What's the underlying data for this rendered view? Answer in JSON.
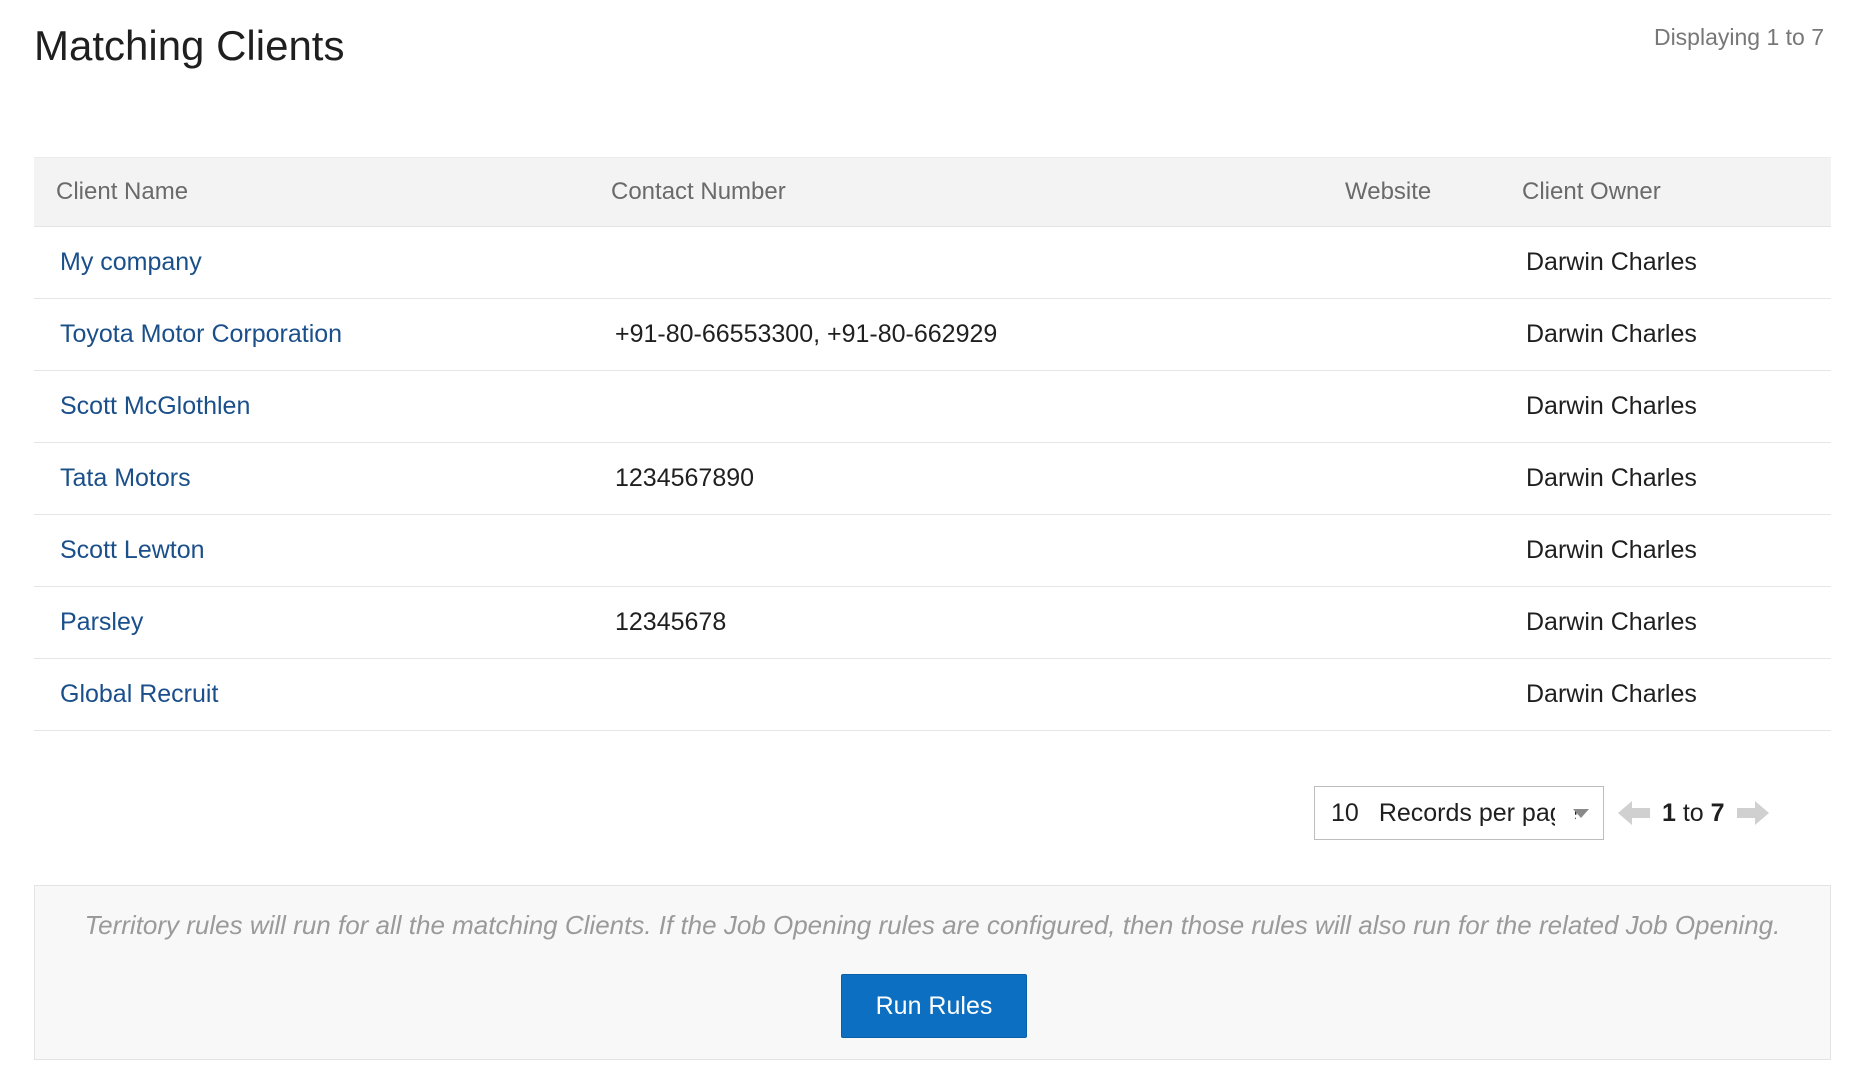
{
  "header": {
    "title": "Matching Clients",
    "displaying": "Displaying 1 to 7"
  },
  "table": {
    "columns": [
      "Client Name",
      "Contact Number",
      "Website",
      "Client Owner"
    ],
    "rows": [
      {
        "client_name": "My company",
        "contact_number": "",
        "website": "",
        "client_owner": "Darwin Charles"
      },
      {
        "client_name": "Toyota Motor Corporation",
        "contact_number": "+91-80-66553300, +91-80-662929",
        "website": "",
        "client_owner": "Darwin Charles"
      },
      {
        "client_name": "Scott McGlothlen",
        "contact_number": "",
        "website": "",
        "client_owner": "Darwin Charles"
      },
      {
        "client_name": "Tata Motors",
        "contact_number": "1234567890",
        "website": "",
        "client_owner": "Darwin Charles"
      },
      {
        "client_name": "Scott Lewton",
        "contact_number": "",
        "website": "",
        "client_owner": "Darwin Charles"
      },
      {
        "client_name": "Parsley",
        "contact_number": "12345678",
        "website": "",
        "client_owner": "Darwin Charles"
      },
      {
        "client_name": "Global Recruit",
        "contact_number": "",
        "website": "",
        "client_owner": "Darwin Charles"
      }
    ]
  },
  "pagination": {
    "records_per_page": "10",
    "records_per_page_label": "Records per page",
    "range_start": "1",
    "range_sep": "to",
    "range_end": "7",
    "prev_icon": "arrow-left-icon",
    "next_icon": "arrow-right-icon"
  },
  "rules": {
    "note": "Territory rules will run for all the matching Clients. If the Job Opening rules are configured, then those rules will also run for the related Job Opening.",
    "button_label": "Run Rules"
  },
  "colors": {
    "link": "#1a4f8a",
    "button": "#0d6fc2",
    "header_bg": "#f3f3f3"
  }
}
